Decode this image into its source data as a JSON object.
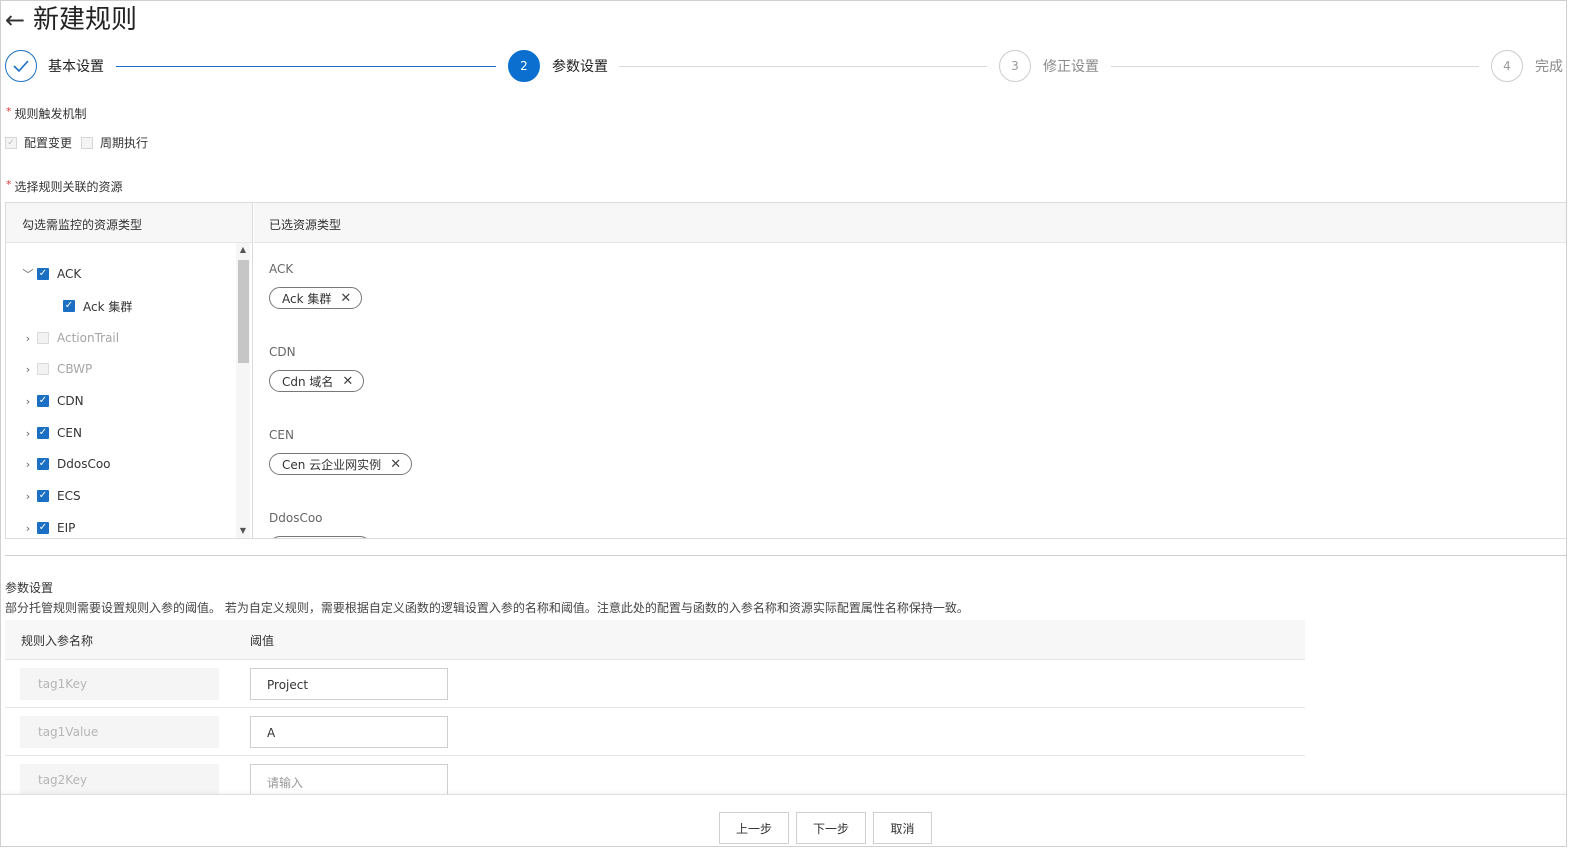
{
  "header": {
    "back_icon": "←",
    "title": "新建规则"
  },
  "steps": [
    {
      "index": "1",
      "label": "基本设置",
      "status": "done"
    },
    {
      "index": "2",
      "label": "参数设置",
      "status": "active"
    },
    {
      "index": "3",
      "label": "修正设置",
      "status": "wait"
    },
    {
      "index": "4",
      "label": "完成",
      "status": "wait"
    }
  ],
  "trigger": {
    "required_mark": "*",
    "label": "规则触发机制",
    "options": [
      {
        "label": "配置变更",
        "checked": true,
        "disabled": true
      },
      {
        "label": "周期执行",
        "checked": false,
        "disabled": true
      }
    ]
  },
  "resources": {
    "required_mark": "*",
    "label": "选择规则关联的资源",
    "left_header": "勾选需监控的资源类型",
    "right_header": "已选资源类型",
    "tree": [
      {
        "label": "ACK",
        "expanded": true,
        "checked": true,
        "dim": false
      },
      {
        "label": "Ack 集群",
        "child": true,
        "checked": true,
        "dim": false
      },
      {
        "label": "ActionTrail",
        "expanded": false,
        "checked": false,
        "dim": true
      },
      {
        "label": "CBWP",
        "expanded": false,
        "checked": false,
        "dim": true
      },
      {
        "label": "CDN",
        "expanded": false,
        "checked": true,
        "dim": false
      },
      {
        "label": "CEN",
        "expanded": false,
        "checked": true,
        "dim": false
      },
      {
        "label": "DdosCoo",
        "expanded": false,
        "checked": true,
        "dim": false
      },
      {
        "label": "ECS",
        "expanded": false,
        "checked": true,
        "dim": false
      },
      {
        "label": "EIP",
        "expanded": false,
        "checked": true,
        "dim": false
      }
    ],
    "selected_groups": [
      {
        "group": "ACK",
        "tags": [
          "Ack 集群"
        ]
      },
      {
        "group": "CDN",
        "tags": [
          "Cdn 域名"
        ]
      },
      {
        "group": "CEN",
        "tags": [
          "Cen 云企业网实例"
        ]
      },
      {
        "group": "DdosCoo",
        "tags": [
          ""
        ]
      }
    ],
    "close_icon": "✕"
  },
  "params": {
    "title": "参数设置",
    "description": "部分托管规则需要设置规则入参的阈值。 若为自定义规则，需要根据自定义函数的逻辑设置入参的名称和阈值。注意此处的配置与函数的入参名称和资源实际配置属性名称保持一致。",
    "col_name": "规则入参名称",
    "col_value": "阈值",
    "rows": [
      {
        "name": "tag1Key",
        "value": "Project",
        "placeholder": ""
      },
      {
        "name": "tag1Value",
        "value": "A",
        "placeholder": ""
      },
      {
        "name": "tag2Key",
        "value": "",
        "placeholder": "请输入"
      }
    ]
  },
  "footer": {
    "prev": "上一步",
    "next": "下一步",
    "cancel": "取消"
  },
  "colors": {
    "accent": "#0b6fcf",
    "step_line": "#1b70c4",
    "required": "#e4393c"
  }
}
